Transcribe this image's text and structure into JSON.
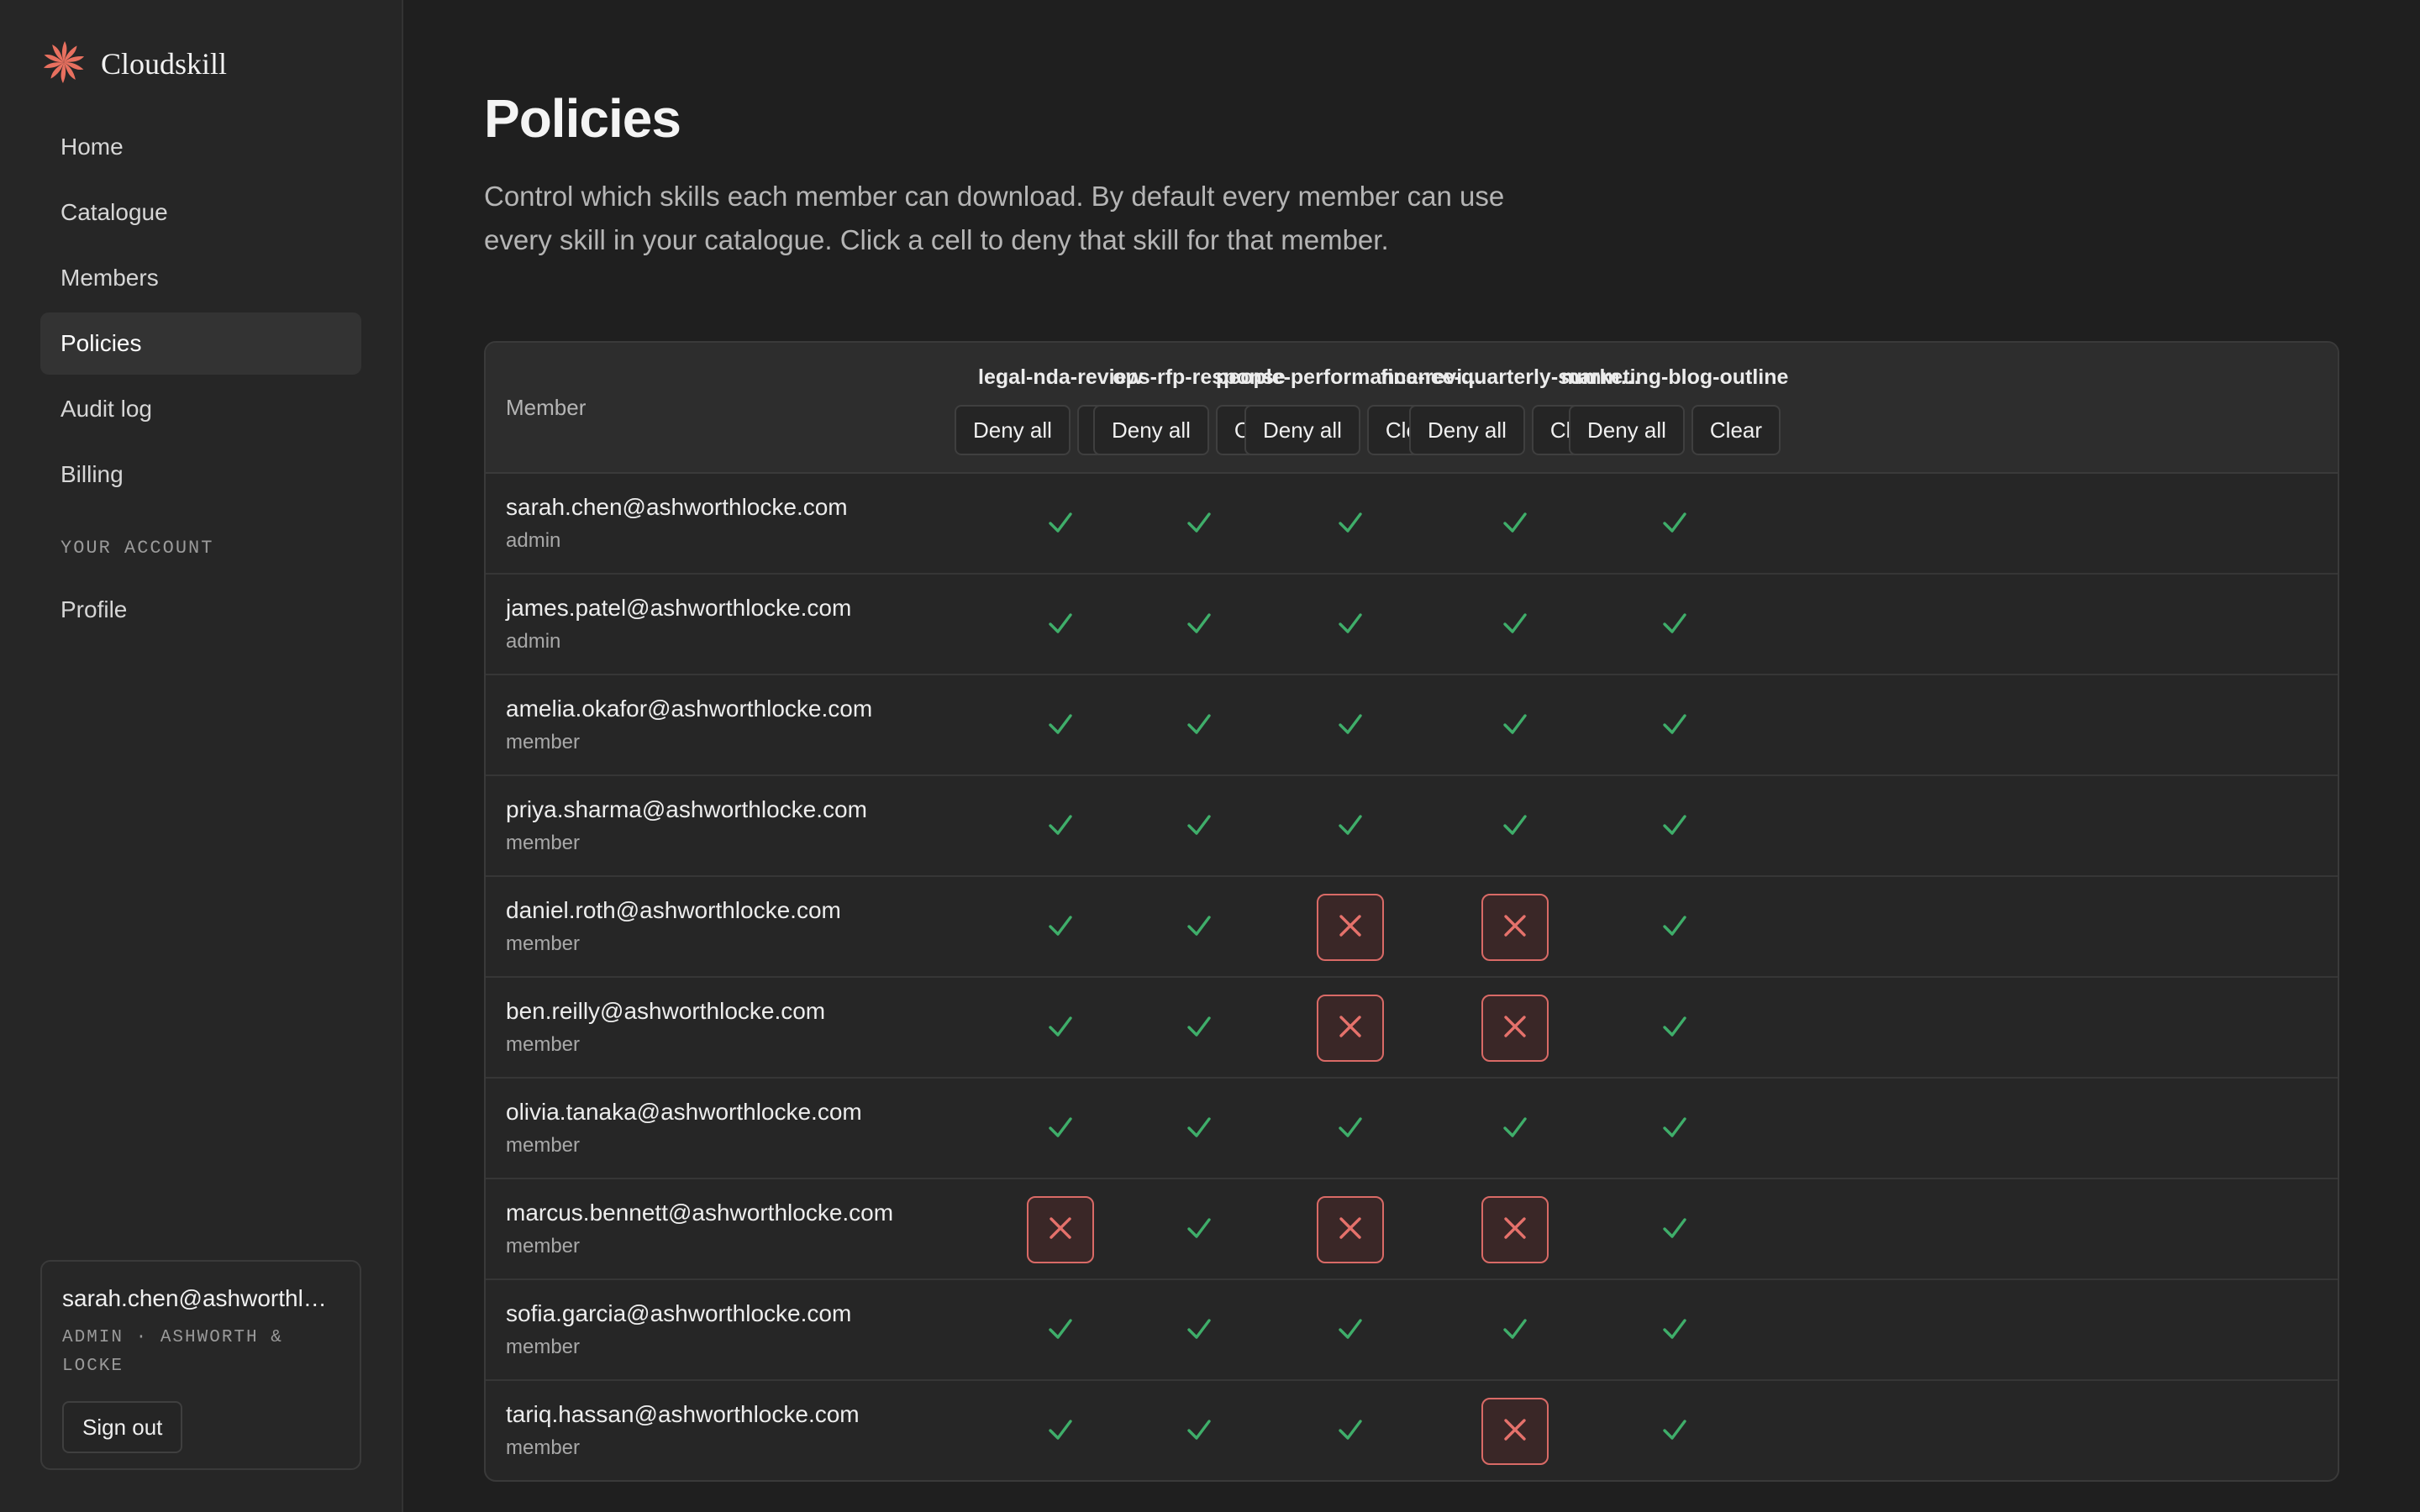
{
  "brand": {
    "name": "Cloudskill",
    "accent": "#e8705f"
  },
  "nav": {
    "items": [
      {
        "label": "Home",
        "active": false
      },
      {
        "label": "Catalogue",
        "active": false
      },
      {
        "label": "Members",
        "active": false
      },
      {
        "label": "Policies",
        "active": true
      },
      {
        "label": "Audit log",
        "active": false
      },
      {
        "label": "Billing",
        "active": false
      }
    ],
    "section_label": "YOUR ACCOUNT",
    "account_items": [
      {
        "label": "Profile"
      }
    ]
  },
  "account": {
    "email": "sarah.chen@ashworthlocke.com",
    "meta": "ADMIN · ASHWORTH & LOCKE",
    "sign_out": "Sign out"
  },
  "page": {
    "title": "Policies",
    "description": "Control which skills each member can download. By default every member can use every skill in your catalogue. Click a cell to deny that skill for that member."
  },
  "table": {
    "member_header": "Member",
    "deny_all_label": "Deny all",
    "clear_label": "Clear",
    "allowed_color": "#3fae6a",
    "denied_color": "#e5716b",
    "skills": [
      "legal-nda-review",
      "ops-rfp-response",
      "people-performance-review",
      "finance-quarterly-summary",
      "marketing-blog-outline"
    ],
    "rows": [
      {
        "email": "sarah.chen@ashworthlocke.com",
        "role": "admin",
        "access": [
          true,
          true,
          true,
          true,
          true
        ]
      },
      {
        "email": "james.patel@ashworthlocke.com",
        "role": "admin",
        "access": [
          true,
          true,
          true,
          true,
          true
        ]
      },
      {
        "email": "amelia.okafor@ashworthlocke.com",
        "role": "member",
        "access": [
          true,
          true,
          true,
          true,
          true
        ]
      },
      {
        "email": "priya.sharma@ashworthlocke.com",
        "role": "member",
        "access": [
          true,
          true,
          true,
          true,
          true
        ]
      },
      {
        "email": "daniel.roth@ashworthlocke.com",
        "role": "member",
        "access": [
          true,
          true,
          false,
          false,
          true
        ]
      },
      {
        "email": "ben.reilly@ashworthlocke.com",
        "role": "member",
        "access": [
          true,
          true,
          false,
          false,
          true
        ]
      },
      {
        "email": "olivia.tanaka@ashworthlocke.com",
        "role": "member",
        "access": [
          true,
          true,
          true,
          true,
          true
        ]
      },
      {
        "email": "marcus.bennett@ashworthlocke.com",
        "role": "member",
        "access": [
          false,
          true,
          false,
          false,
          true
        ]
      },
      {
        "email": "sofia.garcia@ashworthlocke.com",
        "role": "member",
        "access": [
          true,
          true,
          true,
          true,
          true
        ]
      },
      {
        "email": "tariq.hassan@ashworthlocke.com",
        "role": "member",
        "access": [
          true,
          true,
          true,
          false,
          true
        ]
      }
    ]
  }
}
